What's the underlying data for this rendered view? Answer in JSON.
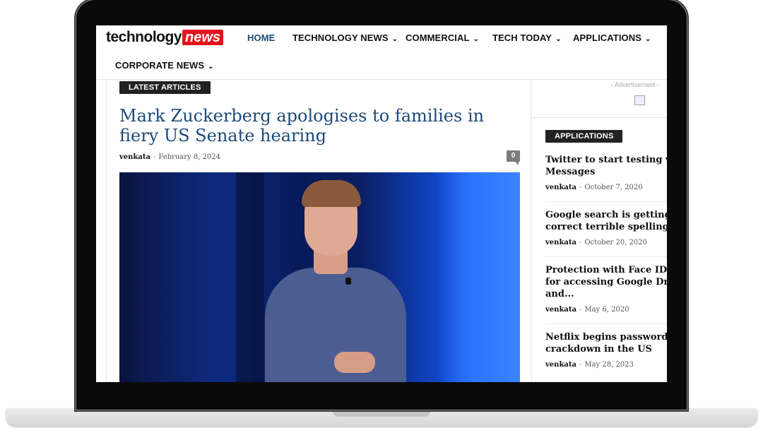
{
  "header": {
    "logo_tech": "technology",
    "logo_news": "news",
    "nav": [
      {
        "label": "HOME"
      },
      {
        "label": "TECHNOLOGY NEWS"
      },
      {
        "label": "COMMERCIAL"
      },
      {
        "label": "TECH TODAY"
      },
      {
        "label": "APPLICATIONS"
      },
      {
        "label": "CORPORATE NEWS"
      }
    ],
    "active_color": "#1b4a78",
    "logo_accent": "#e5121e"
  },
  "main": {
    "section_badge": "LATEST ARTICLES",
    "article": {
      "title": "Mark Zuckerberg apologises to families in fiery US Senate hearing",
      "author": "venkata",
      "separator": "-",
      "date": "February 8, 2024",
      "comments": "0"
    }
  },
  "sidebar": {
    "ad_label": "- Advertisement -",
    "section_badge": "APPLICATIONS",
    "items": [
      {
        "title_line1": "Twitter to start testing voice",
        "title_line2": "Messages",
        "author": "venkata",
        "date": "October 7, 2020"
      },
      {
        "title_line1": "Google search is getting now",
        "title_line2": "correct terrible spellings",
        "author": "venkata",
        "date": "October 20, 2020"
      },
      {
        "title_line1": "Protection with Face ID and",
        "title_line2": "for accessing Google Drive",
        "title_line3": "and...",
        "author": "venkata",
        "date": "May 6, 2020"
      },
      {
        "title_line1": "Netflix begins password sharing",
        "title_line2": "crackdown in the US",
        "author": "venkata",
        "date": "May 28, 2023"
      }
    ],
    "separator": "-"
  }
}
